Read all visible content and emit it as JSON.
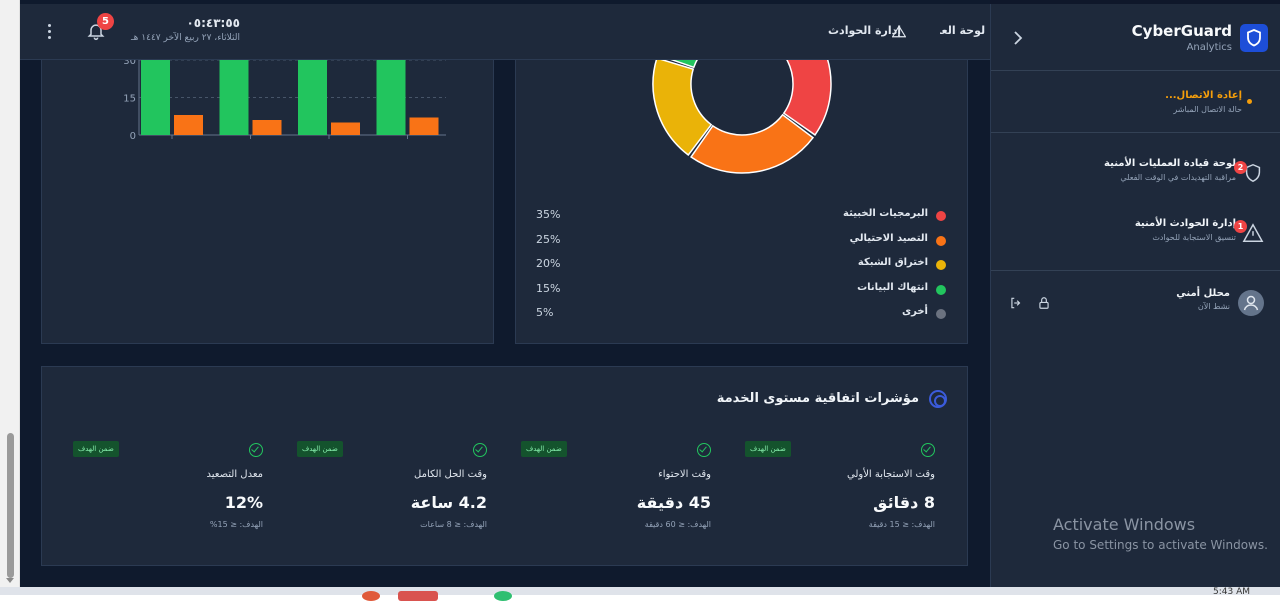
{
  "header": {
    "notification_count": "5",
    "clock_time": "٠٥:٤٣:٥٥",
    "clock_date": "الثلاثاء، ٢٧ ربيع الآخر ١٤٤٧ هـ",
    "nav_incidents": "إدارة الحوادث",
    "nav_ops": "لوحة العمليات"
  },
  "bar_chart": {
    "y_ticks": [
      "30",
      "15",
      "0"
    ]
  },
  "chart_data": [
    {
      "type": "bar",
      "categories": [
        "",
        "",
        "",
        ""
      ],
      "series": [
        {
          "values": [
            30,
            30,
            30,
            30
          ]
        },
        {
          "values": [
            8,
            6,
            5,
            7
          ]
        }
      ],
      "ylim": [
        0,
        30
      ],
      "colors": [
        "#22c55e",
        "#f97316"
      ]
    },
    {
      "type": "pie",
      "labels": [
        "البرمجيات الخبيثة",
        "التصيد الاحتيالي",
        "اختراق الشبكة",
        "انتهاك البيانات",
        "أخرى"
      ],
      "values": [
        35,
        25,
        20,
        15,
        5
      ],
      "colors": [
        "#ef4444",
        "#f97316",
        "#eab308",
        "#22c55e",
        "#6b7280"
      ]
    }
  ],
  "legend": [
    {
      "label": "البرمجيات الخبيثة",
      "pct": "35%",
      "color": "#ef4444"
    },
    {
      "label": "التصيد الاحتيالي",
      "pct": "25%",
      "color": "#f97316"
    },
    {
      "label": "اختراق الشبكة",
      "pct": "20%",
      "color": "#eab308"
    },
    {
      "label": "انتهاك البيانات",
      "pct": "15%",
      "color": "#22c55e"
    },
    {
      "label": "أخرى",
      "pct": "5%",
      "color": "#6b7280"
    }
  ],
  "sla": {
    "title": "مؤشرات اتفاقية مستوى الخدمة",
    "cards": [
      {
        "name": "وقت الاستجابة الأولي",
        "value": "8 دقائق",
        "target": "الهدف: ≤ 15 دقيقة",
        "badge": "ضمن الهدف"
      },
      {
        "name": "وقت الاحتواء",
        "value": "45 دقيقة",
        "target": "الهدف: ≤ 60 دقيقة",
        "badge": "ضمن الهدف"
      },
      {
        "name": "وقت الحل الكامل",
        "value": "4.2 ساعة",
        "target": "الهدف: ≤ 8 ساعات",
        "badge": "ضمن الهدف"
      },
      {
        "name": "معدل التصعيد",
        "value": "12%",
        "target": "الهدف: ≤ 15%",
        "badge": "ضمن الهدف"
      }
    ]
  },
  "sidebar": {
    "brand": "CyberGuard",
    "brand_sub": "Analytics",
    "connection_title": "إعادة الاتصال...",
    "connection_sub": "حالة الاتصال المباشر",
    "items": [
      {
        "title": "لوحة قيادة العمليات الأمنية",
        "sub": "مراقبة التهديدات في الوقت الفعلي",
        "badge": "2"
      },
      {
        "title": "إدارة الحوادث الأمنية",
        "sub": "تنسيق الاستجابة للحوادث",
        "badge": "1"
      }
    ],
    "user_name": "محلل أمني",
    "user_status": "نشط الآن"
  },
  "watermark": {
    "title": "Activate Windows",
    "sub": "Go to Settings to activate Windows."
  },
  "taskbar": {
    "time": "5:43 AM"
  },
  "colors": {
    "accent": "#1d4ed8",
    "warning": "#f59e0b",
    "danger": "#ef4444",
    "success": "#22c55e"
  }
}
